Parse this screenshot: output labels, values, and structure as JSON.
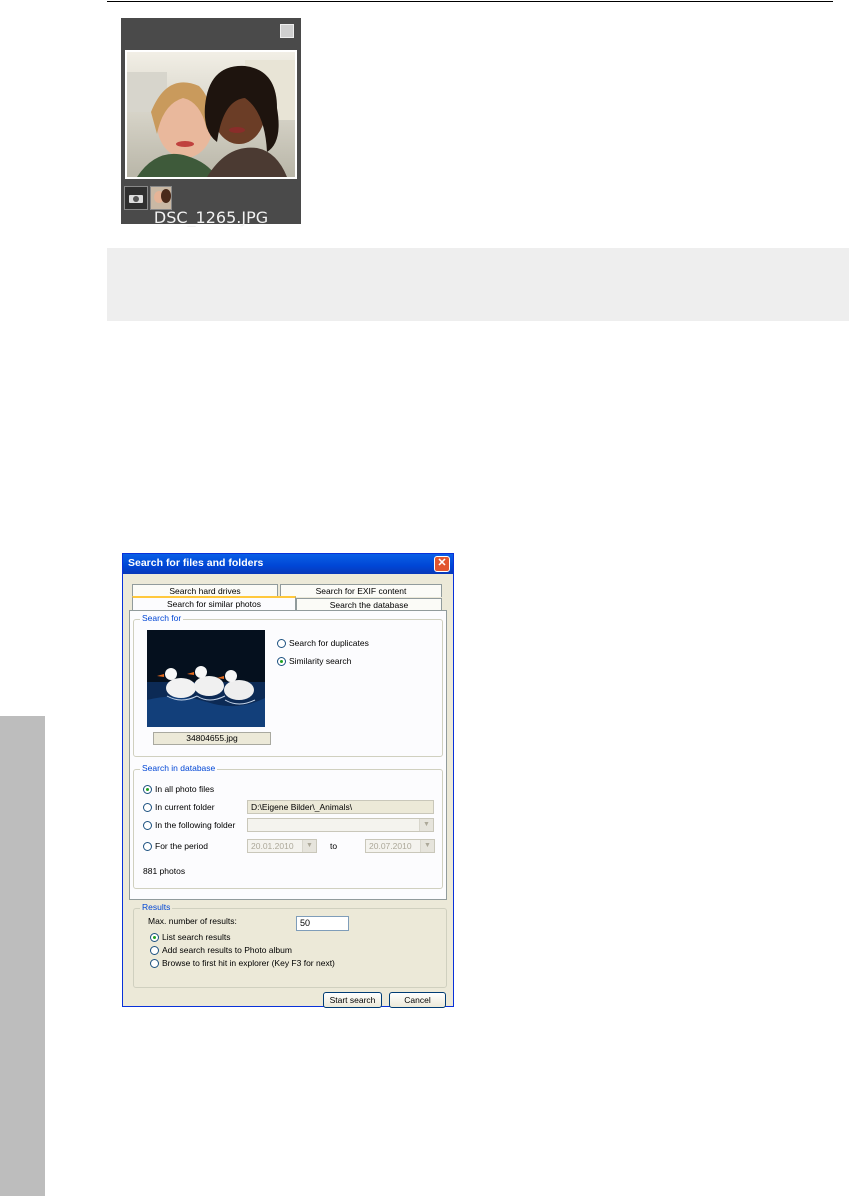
{
  "thumbnail": {
    "filename": "DSC_1265.JPG"
  },
  "dialog": {
    "title": "Search for files and folders",
    "tabs": {
      "row_back": [
        "Search hard drives",
        "Search for EXIF content"
      ],
      "row_front": [
        "Search for similar photos",
        "Search the database"
      ],
      "active": "Search for similar photos"
    },
    "search_for": {
      "legend": "Search for",
      "image_caption": "34804655.jpg",
      "options": [
        "Search for duplicates",
        "Similarity search"
      ],
      "selected": "Similarity search"
    },
    "search_in_database": {
      "legend": "Search in database",
      "options": [
        "In all photo files",
        "In current folder",
        "In the following folder",
        "For the period"
      ],
      "selected": "In all photo files",
      "current_folder_value": "D:\\Eigene Bilder\\_Animals\\",
      "following_folder_value": "",
      "period_from": "20.01.2010",
      "period_to_label": "to",
      "period_to": "20.07.2010",
      "photo_count": "881 photos"
    },
    "results": {
      "legend": "Results",
      "max_label": "Max. number of results:",
      "max_value": "50",
      "options": [
        "List search results",
        "Add search results to Photo album",
        "Browse to first hit in explorer (Key F3 for next)"
      ],
      "selected": "List search results"
    },
    "buttons": {
      "start": "Start search",
      "cancel": "Cancel"
    }
  }
}
